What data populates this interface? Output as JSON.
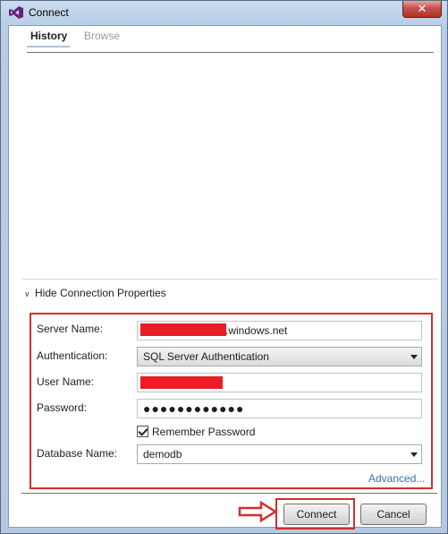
{
  "window": {
    "title": "Connect",
    "close_label": "✕"
  },
  "tabs": [
    {
      "label": "History",
      "active": true
    },
    {
      "label": "Browse",
      "active": false
    }
  ],
  "properties": {
    "toggle_label": "Hide Connection Properties",
    "server_name": {
      "label": "Server Name:",
      "value": ".windows.net"
    },
    "authentication": {
      "label": "Authentication:",
      "value": "SQL Server Authentication"
    },
    "user_name": {
      "label": "User Name:",
      "value": ""
    },
    "password": {
      "label": "Password:",
      "value": "●●●●●●●●●●●●"
    },
    "remember_password": {
      "label": "Remember Password",
      "checked": true
    },
    "database_name": {
      "label": "Database Name:",
      "value": "demodb"
    },
    "advanced_label": "Advanced..."
  },
  "buttons": {
    "connect_label": "Connect",
    "cancel_label": "Cancel"
  },
  "colors": {
    "highlight": "#d32f2f",
    "redaction": "#ec1c24",
    "link": "#3b6fae",
    "vs_purple": "#68217a"
  }
}
